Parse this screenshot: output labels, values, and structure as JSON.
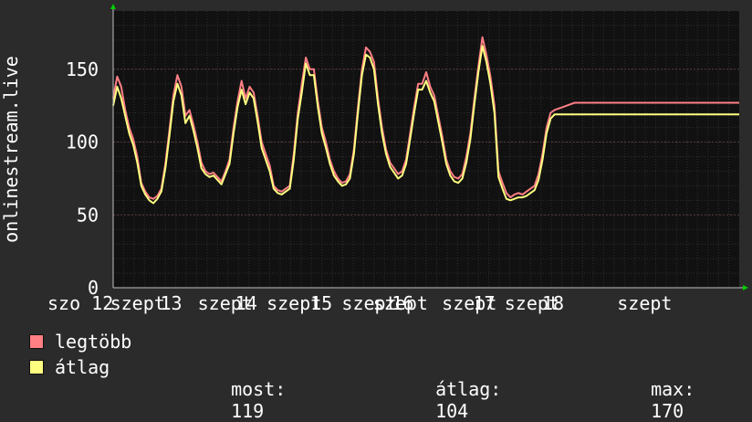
{
  "chart_data": {
    "type": "line",
    "ylabel": "onlinestream.live",
    "ylim": [
      0,
      190
    ],
    "y_ticks": [
      "0",
      "50",
      "100",
      "150"
    ],
    "y_tick_values": [
      0,
      50,
      100,
      150
    ],
    "x_tick_labels": [
      "szo 12",
      "szept",
      "13",
      "szept",
      "14",
      "szept",
      "15",
      "szept",
      "szept",
      "16",
      "szept",
      "17",
      "szept",
      "18",
      "szept"
    ],
    "x_tick_positions": [
      0.0,
      0.1,
      0.18,
      0.24,
      0.3,
      0.35,
      0.42,
      0.47,
      0.52,
      0.55,
      0.63,
      0.68,
      0.73,
      0.79,
      0.91
    ],
    "x_range": [
      0,
      7.8
    ],
    "grid": true,
    "legend_position": "bottom-left",
    "series": [
      {
        "name": "legtöbb",
        "color": "#ff7f85",
        "x": [
          0.0,
          0.05,
          0.1,
          0.15,
          0.2,
          0.25,
          0.3,
          0.35,
          0.4,
          0.45,
          0.5,
          0.55,
          0.6,
          0.65,
          0.7,
          0.75,
          0.8,
          0.85,
          0.9,
          0.95,
          1.0,
          1.05,
          1.1,
          1.15,
          1.2,
          1.25,
          1.3,
          1.35,
          1.4,
          1.45,
          1.5,
          1.55,
          1.6,
          1.65,
          1.7,
          1.75,
          1.8,
          1.85,
          1.9,
          1.95,
          2.0,
          2.05,
          2.1,
          2.15,
          2.2,
          2.25,
          2.3,
          2.35,
          2.4,
          2.45,
          2.5,
          2.55,
          2.6,
          2.65,
          2.7,
          2.75,
          2.8,
          2.85,
          2.9,
          2.95,
          3.0,
          3.05,
          3.1,
          3.15,
          3.2,
          3.25,
          3.3,
          3.35,
          3.4,
          3.45,
          3.5,
          3.55,
          3.6,
          3.65,
          3.7,
          3.75,
          3.8,
          3.85,
          3.9,
          3.95,
          4.0,
          4.05,
          4.1,
          4.15,
          4.2,
          4.25,
          4.3,
          4.35,
          4.4,
          4.45,
          4.5,
          4.55,
          4.6,
          4.65,
          4.7,
          4.75,
          4.8,
          4.85,
          4.9,
          4.95,
          5.0,
          5.05,
          5.1,
          5.15,
          5.2,
          5.25,
          5.3,
          5.35,
          5.4,
          5.45,
          5.5,
          5.55,
          5.6,
          5.65,
          5.7,
          5.75,
          5.8,
          5.85,
          5.9,
          5.95,
          6.0,
          6.05,
          6.1,
          6.15,
          6.2,
          6.25,
          6.3,
          6.35,
          6.4,
          6.45,
          6.5,
          6.55,
          6.6,
          6.65,
          6.7,
          6.75,
          6.8,
          6.85,
          6.9,
          6.95,
          7.0,
          7.05,
          7.1,
          7.15,
          7.2,
          7.25,
          7.3,
          7.35,
          7.4,
          7.45,
          7.5,
          7.55,
          7.6,
          7.65,
          7.7,
          7.75,
          7.8
        ],
        "values": [
          130,
          145,
          138,
          122,
          110,
          102,
          90,
          72,
          66,
          62,
          61,
          63,
          68,
          85,
          108,
          132,
          146,
          138,
          118,
          122,
          112,
          100,
          86,
          80,
          78,
          79,
          76,
          73,
          80,
          88,
          110,
          128,
          142,
          130,
          138,
          134,
          118,
          100,
          92,
          84,
          70,
          67,
          66,
          68,
          70,
          92,
          120,
          140,
          158,
          150,
          150,
          128,
          110,
          100,
          88,
          80,
          75,
          72,
          73,
          78,
          95,
          124,
          150,
          165,
          162,
          155,
          130,
          110,
          95,
          86,
          82,
          78,
          80,
          88,
          106,
          124,
          140,
          140,
          148,
          138,
          132,
          118,
          104,
          88,
          80,
          76,
          75,
          78,
          90,
          106,
          130,
          152,
          172,
          160,
          145,
          125,
          80,
          72,
          65,
          62,
          64,
          65,
          64,
          66,
          68,
          70,
          78,
          92,
          110,
          120,
          122,
          123,
          124,
          125,
          126,
          127,
          127,
          127,
          127,
          127,
          127,
          127,
          127,
          127,
          127,
          127,
          127,
          127,
          127,
          127,
          127,
          127,
          127,
          127,
          127,
          127,
          127,
          127,
          127,
          127,
          127,
          127,
          127,
          127,
          127,
          127,
          127,
          127,
          127,
          127,
          127,
          127,
          127,
          127,
          127,
          127,
          127
        ]
      },
      {
        "name": "átlag",
        "color": "#ffff80",
        "x": [
          0.0,
          0.05,
          0.1,
          0.15,
          0.2,
          0.25,
          0.3,
          0.35,
          0.4,
          0.45,
          0.5,
          0.55,
          0.6,
          0.65,
          0.7,
          0.75,
          0.8,
          0.85,
          0.9,
          0.95,
          1.0,
          1.05,
          1.1,
          1.15,
          1.2,
          1.25,
          1.3,
          1.35,
          1.4,
          1.45,
          1.5,
          1.55,
          1.6,
          1.65,
          1.7,
          1.75,
          1.8,
          1.85,
          1.9,
          1.95,
          2.0,
          2.05,
          2.1,
          2.15,
          2.2,
          2.25,
          2.3,
          2.35,
          2.4,
          2.45,
          2.5,
          2.55,
          2.6,
          2.65,
          2.7,
          2.75,
          2.8,
          2.85,
          2.9,
          2.95,
          3.0,
          3.05,
          3.1,
          3.15,
          3.2,
          3.25,
          3.3,
          3.35,
          3.4,
          3.45,
          3.5,
          3.55,
          3.6,
          3.65,
          3.7,
          3.75,
          3.8,
          3.85,
          3.9,
          3.95,
          4.0,
          4.05,
          4.1,
          4.15,
          4.2,
          4.25,
          4.3,
          4.35,
          4.4,
          4.45,
          4.5,
          4.55,
          4.6,
          4.65,
          4.7,
          4.75,
          4.8,
          4.85,
          4.9,
          4.95,
          5.0,
          5.05,
          5.1,
          5.15,
          5.2,
          5.25,
          5.3,
          5.35,
          5.4,
          5.45,
          5.5,
          5.55,
          5.6,
          5.65,
          5.7,
          5.75,
          5.8,
          5.85,
          5.9,
          5.95,
          6.0,
          6.05,
          6.1,
          6.15,
          6.2,
          6.25,
          6.3,
          6.35,
          6.4,
          6.45,
          6.5,
          6.55,
          6.6,
          6.65,
          6.7,
          6.75,
          6.8,
          6.85,
          6.9,
          6.95,
          7.0,
          7.05,
          7.1,
          7.15,
          7.2,
          7.25,
          7.3,
          7.35,
          7.4,
          7.45,
          7.5,
          7.55,
          7.6,
          7.65,
          7.7,
          7.75,
          7.8
        ],
        "values": [
          125,
          138,
          130,
          118,
          106,
          98,
          86,
          70,
          64,
          60,
          58,
          61,
          66,
          82,
          104,
          128,
          140,
          132,
          113,
          118,
          108,
          96,
          82,
          78,
          76,
          77,
          74,
          71,
          78,
          85,
          106,
          124,
          136,
          126,
          134,
          130,
          114,
          96,
          88,
          80,
          68,
          65,
          64,
          66,
          68,
          88,
          116,
          134,
          154,
          146,
          146,
          124,
          106,
          96,
          85,
          77,
          73,
          70,
          71,
          75,
          92,
          120,
          146,
          160,
          158,
          150,
          126,
          106,
          92,
          83,
          79,
          75,
          77,
          85,
          102,
          120,
          136,
          136,
          142,
          134,
          128,
          114,
          100,
          85,
          77,
          73,
          72,
          75,
          86,
          102,
          126,
          148,
          166,
          155,
          140,
          120,
          76,
          68,
          61,
          60,
          61,
          62,
          62,
          63,
          65,
          67,
          74,
          88,
          106,
          116,
          119,
          119,
          119,
          119,
          119,
          119,
          119,
          119,
          119,
          119,
          119,
          119,
          119,
          119,
          119,
          119,
          119,
          119,
          119,
          119,
          119,
          119,
          119,
          119,
          119,
          119,
          119,
          119,
          119,
          119,
          119,
          119,
          119,
          119,
          119,
          119,
          119,
          119,
          119,
          119,
          119,
          119,
          119,
          119,
          119,
          119,
          119
        ]
      }
    ],
    "colors": {
      "background": "#2b2b2b",
      "plot_background": "#111111",
      "grid": "#3b3b3b",
      "minor_grid": "#2e2e2e",
      "axis": "#c0c0c0",
      "arrow": "#00cc00"
    }
  },
  "legend": [
    {
      "label": "legtöbb",
      "color": "#ff7f85"
    },
    {
      "label": "átlag",
      "color": "#ffff80"
    }
  ],
  "stats": {
    "most_label": "most:",
    "most_value": "119",
    "atlag_label": "átlag:",
    "atlag_value": "104",
    "max_label": "max:",
    "max_value": "170"
  }
}
